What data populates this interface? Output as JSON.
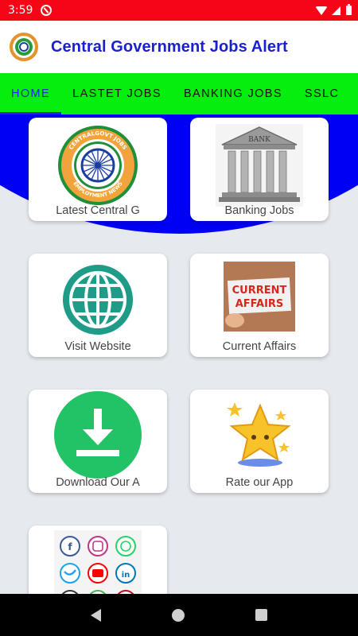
{
  "status": {
    "time": "3:59"
  },
  "app": {
    "title": "Central Government Jobs Alert"
  },
  "tabs": [
    {
      "label": "HOME"
    },
    {
      "label": "LASTET JOBS"
    },
    {
      "label": "BANKING JOBS"
    },
    {
      "label": "SSLC"
    }
  ],
  "cards": [
    {
      "label": "Latest Central G",
      "icon": "emblem-icon",
      "image_text_top": "CENTRALGOVT JOBS",
      "image_text_bottom": "EMPLOYMENT NEWS"
    },
    {
      "label": "Banking Jobs",
      "icon": "bank-icon",
      "image_text": "BANK"
    },
    {
      "label": "Visit Website",
      "icon": "globe-icon"
    },
    {
      "label": "Current Affairs",
      "icon": "current-affairs-icon",
      "image_text_line1": "CURRENT",
      "image_text_line2": "AFFAIRS"
    },
    {
      "label": "Download Our A",
      "icon": "download-icon"
    },
    {
      "label": "Rate our App",
      "icon": "star-icon"
    },
    {
      "label": "",
      "icon": "social-share-icon"
    }
  ],
  "colors": {
    "status_bar": "#f50515",
    "tab_bar": "#05ee0d",
    "accent": "#1b29d0",
    "arc": "#0000f5",
    "globe": "#1f9c88",
    "download": "#22c266"
  }
}
